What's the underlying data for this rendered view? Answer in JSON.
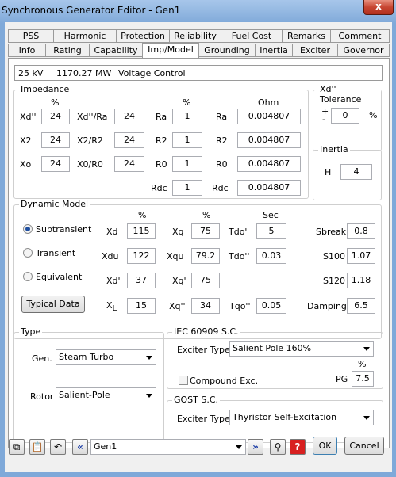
{
  "window": {
    "title": "Synchronous Generator Editor - Gen1",
    "close_label": "x"
  },
  "tabs_row1": [
    "PSS",
    "Harmonic",
    "Protection",
    "Reliability",
    "Fuel Cost",
    "Remarks",
    "Comment"
  ],
  "tabs_row2": [
    "Info",
    "Rating",
    "Capability",
    "Imp/Model",
    "Grounding",
    "Inertia",
    "Exciter",
    "Governor"
  ],
  "active_tab": "Imp/Model",
  "info": {
    "voltage": "25 kV",
    "power": "1170.27 MW",
    "mode": "Voltage Control"
  },
  "impedance": {
    "title": "Impedance",
    "pct_header1": "%",
    "pct_header2": "%",
    "ohm_header": "Ohm",
    "rows": [
      {
        "l1": "Xd''",
        "v1": "24",
        "l2": "Xd''/Ra",
        "v2": "24",
        "l3": "Ra",
        "v3": "1",
        "l4": "Ra",
        "v4": "0.004807"
      },
      {
        "l1": "X2",
        "v1": "24",
        "l2": "X2/R2",
        "v2": "24",
        "l3": "R2",
        "v3": "1",
        "l4": "R2",
        "v4": "0.004807"
      },
      {
        "l1": "Xo",
        "v1": "24",
        "l2": "X0/R0",
        "v2": "24",
        "l3": "R0",
        "v3": "1",
        "l4": "R0",
        "v4": "0.004807"
      }
    ],
    "rdc_label": "Rdc",
    "rdc_pct": "1",
    "rdc_label2": "Rdc",
    "rdc_ohm": "0.004807"
  },
  "tolerance": {
    "title": "Xd'' Tolerance",
    "plus": "+",
    "minus": "-",
    "value": "0",
    "unit": "%"
  },
  "inertia": {
    "title": "Inertia",
    "label": "H",
    "value": "4"
  },
  "dynamic": {
    "title": "Dynamic Model",
    "hdr_pct1": "%",
    "hdr_pct2": "%",
    "hdr_sec": "Sec",
    "radios": [
      "Subtransient",
      "Transient",
      "Equivalent"
    ],
    "selected": "Subtransient",
    "typical_data": "Typical Data",
    "xd": {
      "label": "Xd",
      "value": "115"
    },
    "xq": {
      "label": "Xq",
      "value": "75"
    },
    "tdo1": {
      "label": "Tdo'",
      "value": "5"
    },
    "sbreak": {
      "label": "Sbreak",
      "value": "0.8"
    },
    "xdu": {
      "label": "Xdu",
      "value": "122"
    },
    "xqu": {
      "label": "Xqu",
      "value": "79.2"
    },
    "tdo2": {
      "label": "Tdo''",
      "value": "0.03"
    },
    "s100": {
      "label": "S100",
      "value": "1.07"
    },
    "xd1": {
      "label": "Xd'",
      "value": "37"
    },
    "xq1": {
      "label": "Xq'",
      "value": "75"
    },
    "s120": {
      "label": "S120",
      "value": "1.18"
    },
    "xl": {
      "label": "X",
      "sub": "L",
      "value": "15"
    },
    "xq2": {
      "label": "Xq''",
      "value": "34"
    },
    "tqo": {
      "label": "Tqo''",
      "value": "0.05"
    },
    "damping": {
      "label": "Damping",
      "value": "6.5"
    }
  },
  "type": {
    "title": "Type",
    "gen_label": "Gen.",
    "gen_value": "Steam Turbo",
    "rotor_label": "Rotor",
    "rotor_value": "Salient-Pole"
  },
  "iec": {
    "title": "IEC 60909 S.C.",
    "exciter_label": "Exciter Type",
    "exciter_value": "Salient Pole 160%",
    "compound_label": "Compound Exc.",
    "pg_pct": "%",
    "pg_label": "PG",
    "pg_value": "7.5"
  },
  "gost": {
    "title": "GOST S.C.",
    "exciter_label": "Exciter Type",
    "exciter_value": "Thyristor Self-Excitation"
  },
  "bottom": {
    "nav_value": "Gen1",
    "ok": "OK",
    "cancel": "Cancel"
  }
}
